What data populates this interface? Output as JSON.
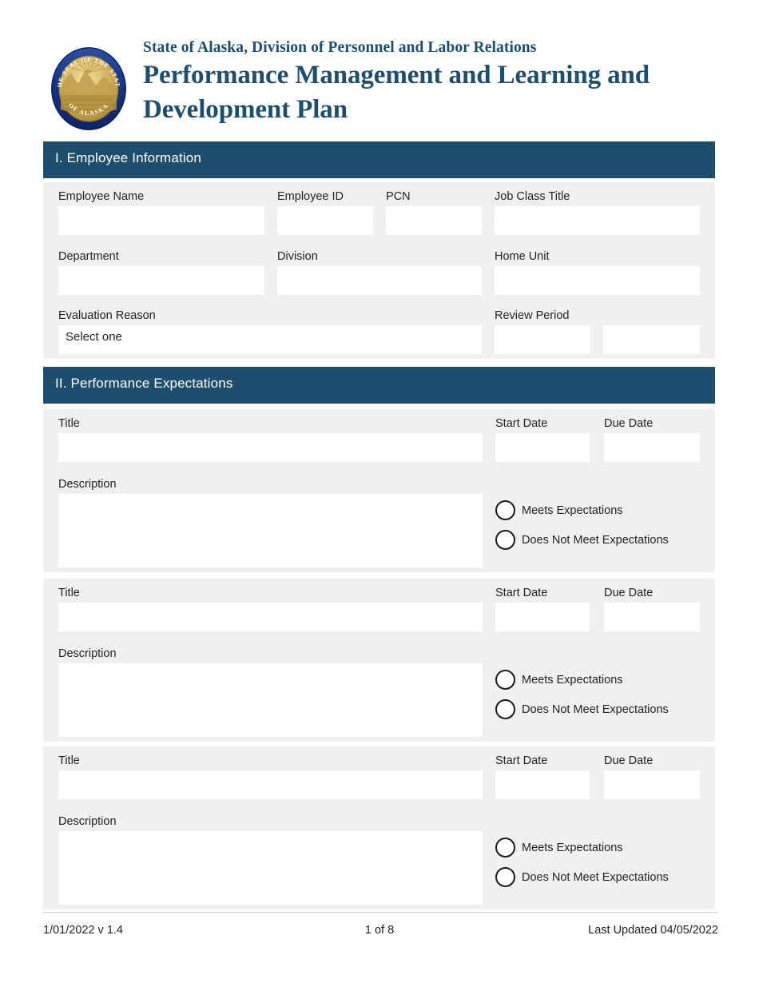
{
  "header": {
    "org_line": "State of Alaska, Division of Personnel and Labor Relations",
    "title_line1": "Performance Management and Learning and",
    "title_line2": "Development Plan",
    "seal": {
      "icon": "alaska-state-seal",
      "ring_text_top": "THE SEAL OF THE STATE",
      "ring_text_bottom": "OF ALASKA",
      "ring_color": "#1f3f8f",
      "center_color": "#c9a227"
    },
    "brand_color": "#1d4e6e"
  },
  "sections": [
    {
      "id": "employee-information",
      "band_label": "I. Employee Information"
    },
    {
      "id": "performance-expectations",
      "band_label": "II. Performance Expectations"
    }
  ],
  "employee_information": {
    "fields": {
      "employee_name": {
        "label": "Employee Name",
        "value": ""
      },
      "employee_id": {
        "label": "Employee ID",
        "value": ""
      },
      "pcn": {
        "label": "PCN",
        "value": ""
      },
      "job_class_title": {
        "label": "Job Class Title",
        "value": ""
      },
      "department": {
        "label": "Department",
        "value": ""
      },
      "division": {
        "label": "Division",
        "value": ""
      },
      "home_unit": {
        "label": "Home Unit",
        "value": ""
      },
      "evaluation_reason": {
        "label": "Evaluation Reason",
        "value": "Select one",
        "placeholder": "Select one"
      },
      "review_period": {
        "label": "Review Period",
        "from_value": "",
        "to_value": ""
      }
    }
  },
  "performance_expectations": {
    "labels": {
      "title": "Title",
      "start_date": "Start Date",
      "due_date": "Due Date",
      "description": "Description",
      "meets": "Meets Expectations",
      "does_not_meet": "Does Not Meet Expectations"
    },
    "items": [
      {
        "title": "",
        "start_date": "",
        "due_date": "",
        "description": "",
        "rating": ""
      },
      {
        "title": "",
        "start_date": "",
        "due_date": "",
        "description": "",
        "rating": ""
      },
      {
        "title": "",
        "start_date": "",
        "due_date": "",
        "description": "",
        "rating": ""
      }
    ]
  },
  "footer": {
    "left": "1/01/2022 v 1.4",
    "center": "1 of 8",
    "right": "Last Updated 04/05/2022"
  }
}
